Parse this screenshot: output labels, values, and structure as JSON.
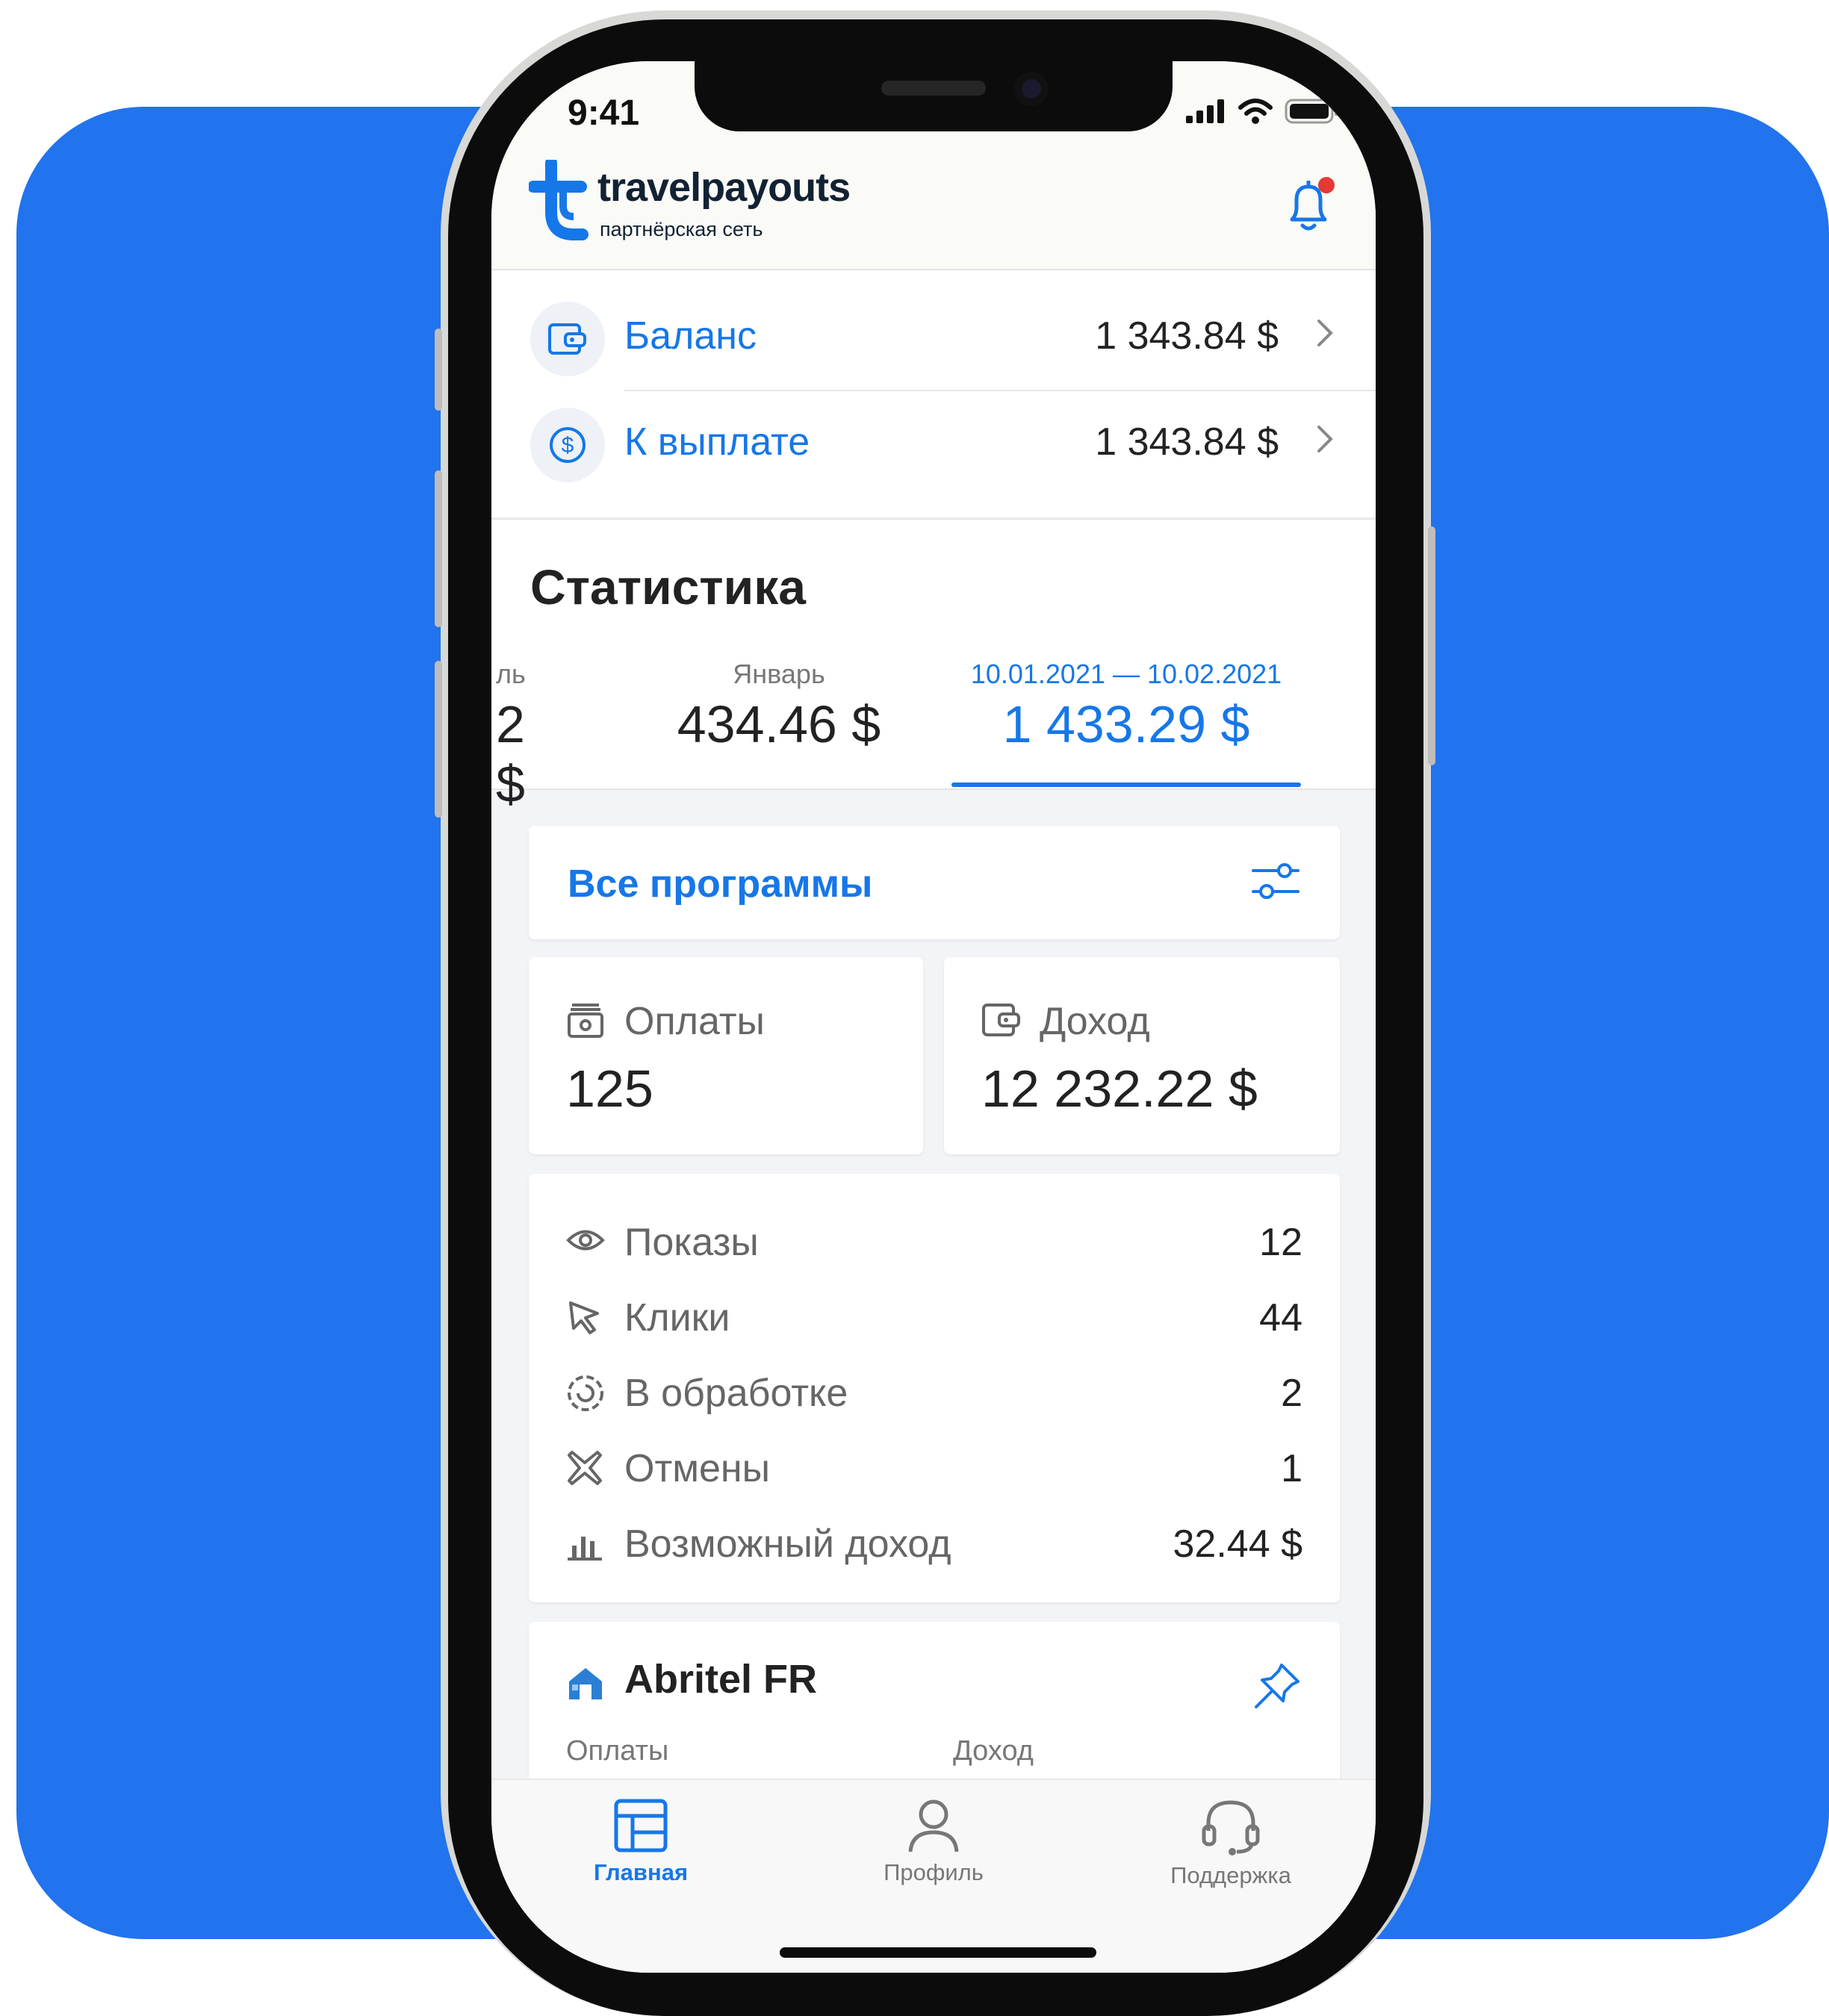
{
  "status_bar": {
    "time": "9:41"
  },
  "brand": {
    "name": "travelpayouts",
    "tagline": "партнёрская сеть",
    "accent": "#1677e8",
    "background": "#2173ee"
  },
  "balances": [
    {
      "label": "Баланс",
      "value": "1 343.84 $",
      "icon": "wallet-icon"
    },
    {
      "label": "К выплате",
      "value": "1 343.84 $",
      "icon": "dollar-circle-icon"
    }
  ],
  "stats": {
    "title": "Статистика",
    "periods": [
      {
        "label": "ль",
        "value": "2 $"
      },
      {
        "label": "Январь",
        "value": "434.46 $"
      },
      {
        "label": "10.01.2021 — 10.02.2021",
        "value": "1 433.29 $",
        "active": true
      }
    ],
    "filter_label": "Все программы",
    "payments": {
      "label": "Оплаты",
      "value": "125"
    },
    "income": {
      "label": "Доход",
      "value": "12 232.22 $"
    },
    "metrics": [
      {
        "label": "Показы",
        "value": "12",
        "icon": "eye-icon"
      },
      {
        "label": "Клики",
        "value": "44",
        "icon": "cursor-icon"
      },
      {
        "label": "В обработке",
        "value": "2",
        "icon": "processing-icon"
      },
      {
        "label": "Отмены",
        "value": "1",
        "icon": "cancel-icon"
      },
      {
        "label": "Возможный доход",
        "value": "32.44 $",
        "icon": "bar-chart-icon"
      }
    ],
    "program": {
      "name": "Abritel FR",
      "col1": "Оплаты",
      "col2": "Доход"
    }
  },
  "tabbar": [
    {
      "label": "Главная",
      "icon": "home-table-icon",
      "active": true
    },
    {
      "label": "Профиль",
      "icon": "person-icon"
    },
    {
      "label": "Поддержка",
      "icon": "headset-icon"
    }
  ]
}
